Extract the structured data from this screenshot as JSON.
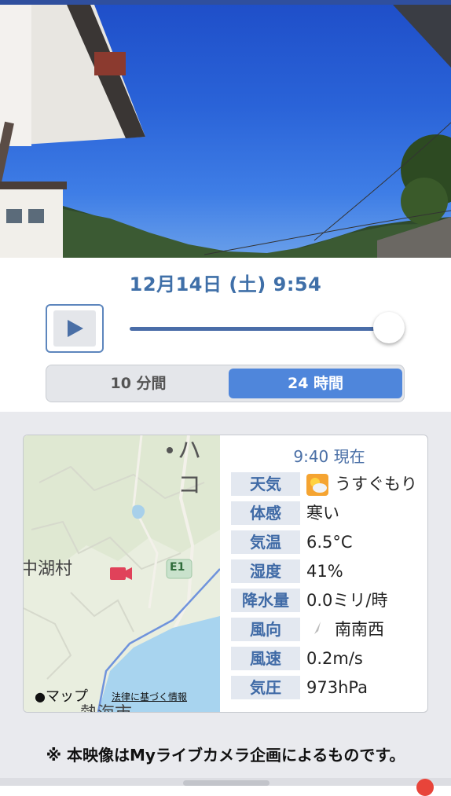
{
  "datetime": "12月14日 (土) 9:54",
  "player": {
    "progress_percent": 100
  },
  "segments": {
    "option_10min": "10 分間",
    "option_24h": "24 時間",
    "selected": "24 時間"
  },
  "map": {
    "place_fragment_top": "ハコ",
    "place_lake_village": "中湖村",
    "road_badge": "E1",
    "place_fragment_bottom": "熱海市",
    "attribution_apple": "マップ",
    "attribution_legal": "法律に基づく情報",
    "camera_marker_icon": "video-camera-icon"
  },
  "weather": {
    "time_label": "9:40 現在",
    "rows": [
      {
        "label": "天気",
        "value": "うすぐもり",
        "icon": "partly-cloudy-icon"
      },
      {
        "label": "体感",
        "value": "寒い"
      },
      {
        "label": "気温",
        "value": "6.5°C"
      },
      {
        "label": "湿度",
        "value": "41%"
      },
      {
        "label": "降水量",
        "value": "0.0ミリ/時"
      },
      {
        "label": "風向",
        "value": "南南西",
        "icon": "wind-direction-arrow-icon"
      },
      {
        "label": "風速",
        "value": "0.2m/s"
      },
      {
        "label": "気圧",
        "value": "973hPa"
      }
    ]
  },
  "footer_note": "※ 本映像はMyライブカメラ企画によるものです。",
  "colors": {
    "accent": "#4f86db",
    "label_text": "#3f6aa6",
    "camera_icon": "#e0425a"
  }
}
